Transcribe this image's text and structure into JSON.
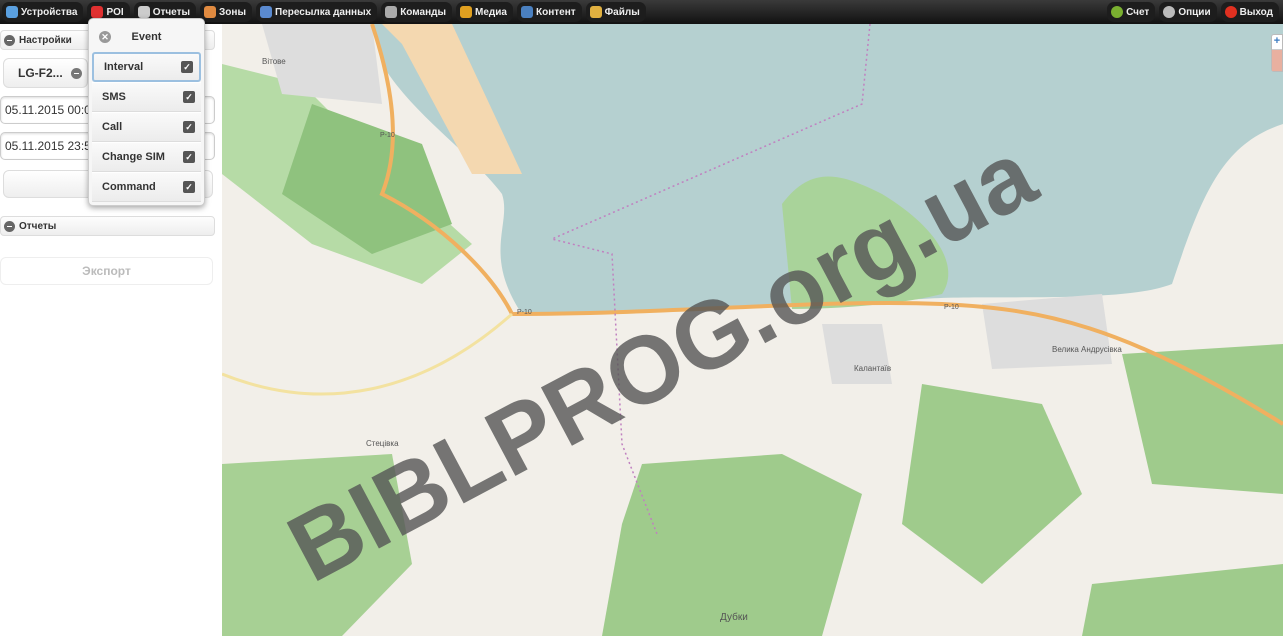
{
  "nav": {
    "items": [
      {
        "label": "Устройства",
        "icon": "eye-icon",
        "color": "#5aa0e0"
      },
      {
        "label": "POI",
        "icon": "pin-icon",
        "color": "#e03030"
      },
      {
        "label": "Отчеты",
        "icon": "report-icon",
        "color": "#ccc"
      },
      {
        "label": "Зоны",
        "icon": "zone-icon",
        "color": "#e08a40"
      },
      {
        "label": "Пересылка данных",
        "icon": "user-icon",
        "color": "#5a8ad0"
      },
      {
        "label": "Команды",
        "icon": "server-icon",
        "color": "#aaa"
      },
      {
        "label": "Медиа",
        "icon": "music-icon",
        "color": "#e0a020"
      },
      {
        "label": "Контент",
        "icon": "globe-icon",
        "color": "#4a80c0"
      },
      {
        "label": "Файлы",
        "icon": "folder-icon",
        "color": "#e0b040"
      }
    ],
    "right": [
      {
        "label": "Счет",
        "icon": "dollar-icon",
        "color": "#7ab030"
      },
      {
        "label": "Опции",
        "icon": "gear-icon",
        "color": "#bbb"
      },
      {
        "label": "Выход",
        "icon": "power-icon",
        "color": "#e03020"
      }
    ]
  },
  "sidebar": {
    "settings_label": "Настройки",
    "device": "LG-F2...",
    "date_from": "05.11.2015 00:0",
    "date_to": "05.11.2015 23:5",
    "submit_label": "За",
    "reports_label": "Отчеты",
    "export_label": "Экспорт"
  },
  "menu": {
    "title": "Event",
    "items": [
      {
        "label": "Interval",
        "checked": true
      },
      {
        "label": "SMS",
        "checked": true
      },
      {
        "label": "Call",
        "checked": true
      },
      {
        "label": "Change SIM",
        "checked": true
      },
      {
        "label": "Command",
        "checked": true
      }
    ]
  },
  "map": {
    "labels": {
      "v1": "Вітове",
      "v2": "Калантаїв",
      "v3": "Велика Андрусівка",
      "v4": "Дубки",
      "v5": "Стецівка",
      "road": "Р-10"
    },
    "zoom_in": "+"
  },
  "watermark": "BIBLPROG.org.ua"
}
